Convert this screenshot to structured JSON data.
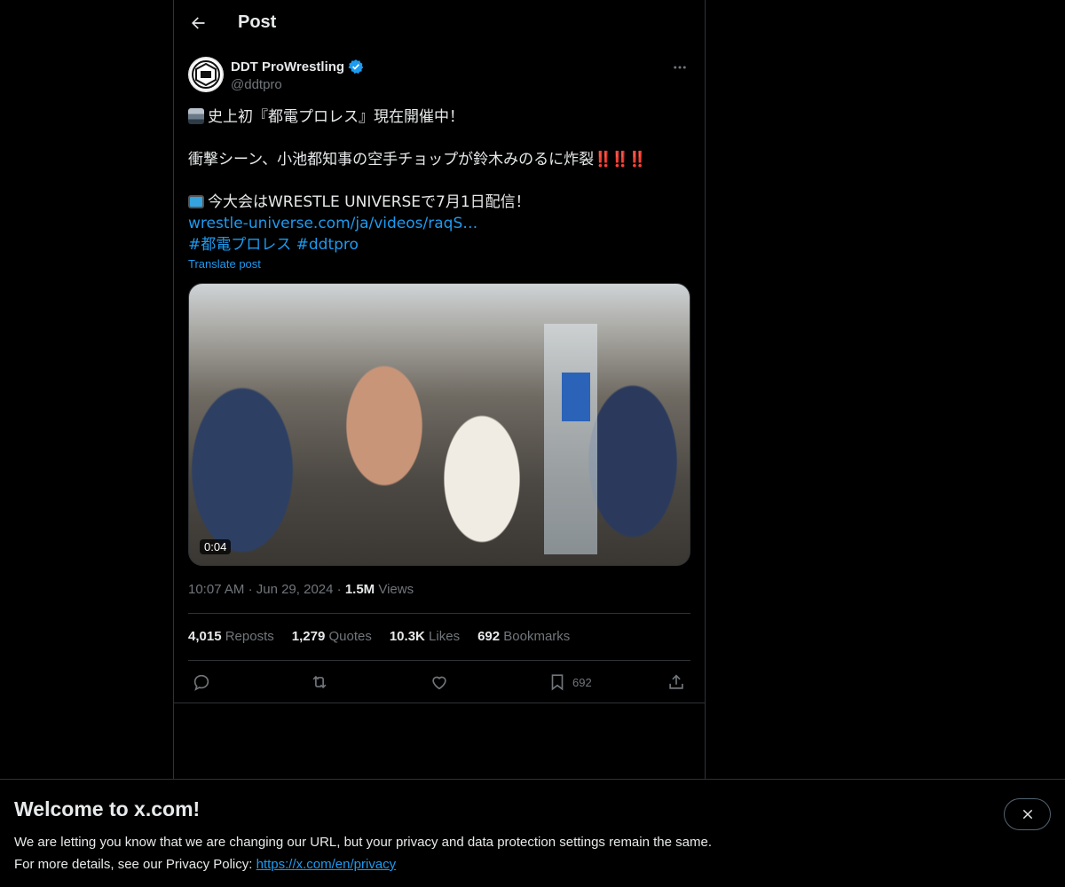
{
  "header": {
    "title": "Post"
  },
  "author": {
    "display_name": "DDT ProWrestling",
    "handle": "@ddtpro",
    "verified": true
  },
  "tweet": {
    "line1": "史上初『都電プロレス』現在開催中！",
    "line2": "衝撃シーン、小池都知事の空手チョップが鈴木みのるに炸裂",
    "line2_emphasis": "‼️‼️‼️",
    "line3": "今大会はWRESTLE UNIVERSEで7月1日配信！",
    "link_text": "wrestle-universe.com/ja/videos/raqS…",
    "hashtags": "#都電プロレス #ddtpro",
    "translate_label": "Translate post"
  },
  "media": {
    "duration": "0:04"
  },
  "meta": {
    "time": "10:07 AM",
    "separator": "·",
    "date": "Jun 29, 2024",
    "views_count": "1.5M",
    "views_label": "Views"
  },
  "stats": {
    "reposts_count": "4,015",
    "reposts_label": "Reposts",
    "quotes_count": "1,279",
    "quotes_label": "Quotes",
    "likes_count": "10.3K",
    "likes_label": "Likes",
    "bookmarks_count": "692",
    "bookmarks_label": "Bookmarks"
  },
  "actions": {
    "bookmark_count": "692"
  },
  "banner": {
    "title": "Welcome to x.com!",
    "line1": "We are letting you know that we are changing our URL, but your privacy and data protection settings remain the same.",
    "line2_prefix": "For more details, see our Privacy Policy:",
    "privacy_link": "https://x.com/en/privacy"
  },
  "colors": {
    "accent": "#1d9bf0",
    "background": "#000000",
    "muted": "#71767b",
    "text": "#e7e9ea",
    "verified": "#1d9bf0"
  }
}
